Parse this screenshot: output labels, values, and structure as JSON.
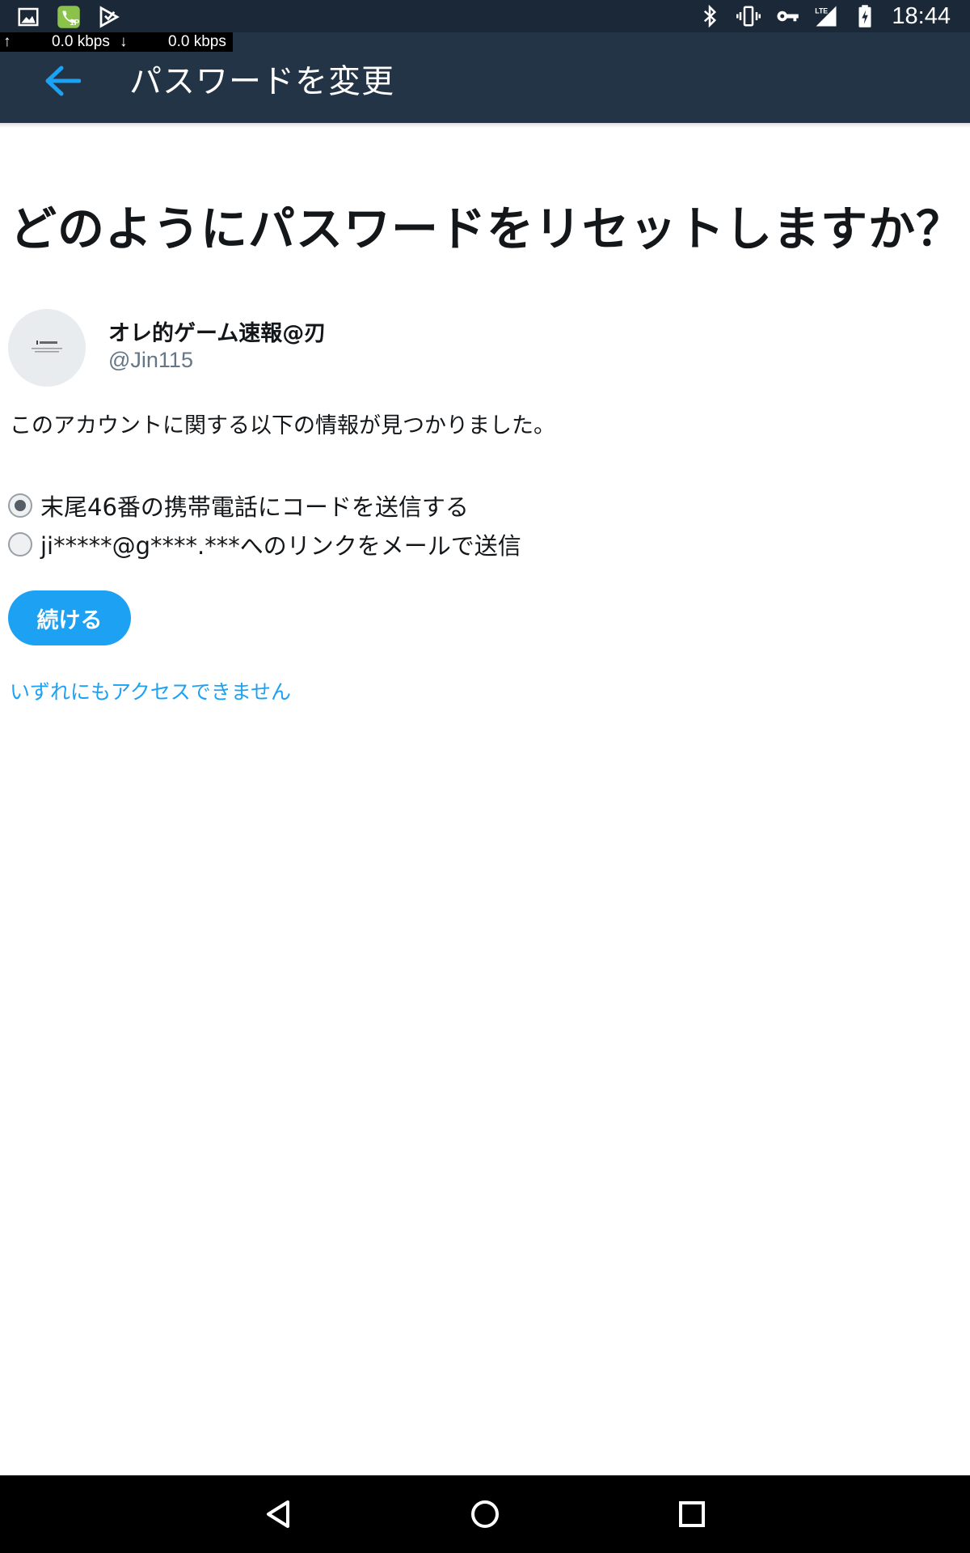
{
  "status_bar": {
    "time": "18:44",
    "icons": [
      "image-icon",
      "call-recording-icon",
      "play-store-icon",
      "bluetooth-icon",
      "vibrate-icon",
      "vpn-key-icon",
      "lte-signal-icon",
      "battery-charging-icon"
    ],
    "upload_speed": "0.0 kbps",
    "download_speed": "0.0 kbps"
  },
  "app_bar": {
    "title": "パスワードを変更"
  },
  "main": {
    "heading": "どのようにパスワードをリセットしますか？",
    "account": {
      "name": "オレ的ゲーム速報@刃",
      "handle": "@Jin115"
    },
    "info_text": "このアカウントに関する以下の情報が見つかりました。",
    "options": [
      {
        "label": "末尾46番の携帯電話にコードを送信する",
        "selected": true
      },
      {
        "label": "ji*****@g****.***へのリンクをメールで送信",
        "selected": false
      }
    ],
    "continue_label": "続ける",
    "no_access_link": "いずれにもアクセスできません"
  },
  "colors": {
    "status_bar_bg": "#1b2838",
    "app_bar_bg": "#243447",
    "accent": "#1da1f2",
    "text_primary": "#14171a",
    "text_secondary": "#657786"
  }
}
